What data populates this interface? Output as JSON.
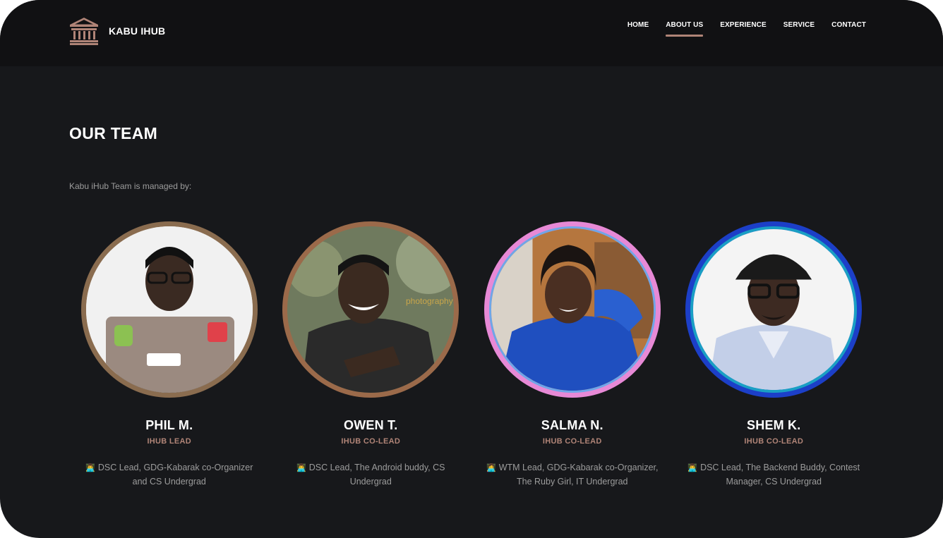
{
  "brand": {
    "name": "KABU IHUB",
    "icon": "bank-icon",
    "accent": "#b08477"
  },
  "nav": {
    "items": [
      {
        "label": "HOME",
        "active": false
      },
      {
        "label": "ABOUT US",
        "active": true
      },
      {
        "label": "EXPERIENCE",
        "active": false
      },
      {
        "label": "SERVICE",
        "active": false
      },
      {
        "label": "CONTACT",
        "active": false
      }
    ]
  },
  "section": {
    "title": "OUR TEAM",
    "intro": "Kabu iHub Team is managed by:"
  },
  "team": [
    {
      "name": "PHIL M.",
      "role": "IHUB LEAD",
      "emoji": "👨‍💻",
      "bio": "DSC Lead, GDG-Kabarak co-Organizer and CS Undergrad",
      "ring_color": "#8a6c4f"
    },
    {
      "name": "OWEN T.",
      "role": "IHUB CO-LEAD",
      "emoji": "👨‍💻",
      "bio": "DSC Lead, The Android buddy, CS Undergrad",
      "ring_color": "#9b6a4a"
    },
    {
      "name": "SALMA N.",
      "role": "IHUB CO-LEAD",
      "emoji": "👩‍💻",
      "bio": "WTM Lead, GDG-Kabarak co-Organizer, The Ruby Girl, IT Undergrad",
      "ring_color": "#e789d6"
    },
    {
      "name": "SHEM K.",
      "role": "IHUB CO-LEAD",
      "emoji": "👨‍💻",
      "bio": "DSC Lead, The Backend Buddy, Contest Manager, CS Undergrad",
      "ring_color": "#1c3fc8"
    }
  ]
}
